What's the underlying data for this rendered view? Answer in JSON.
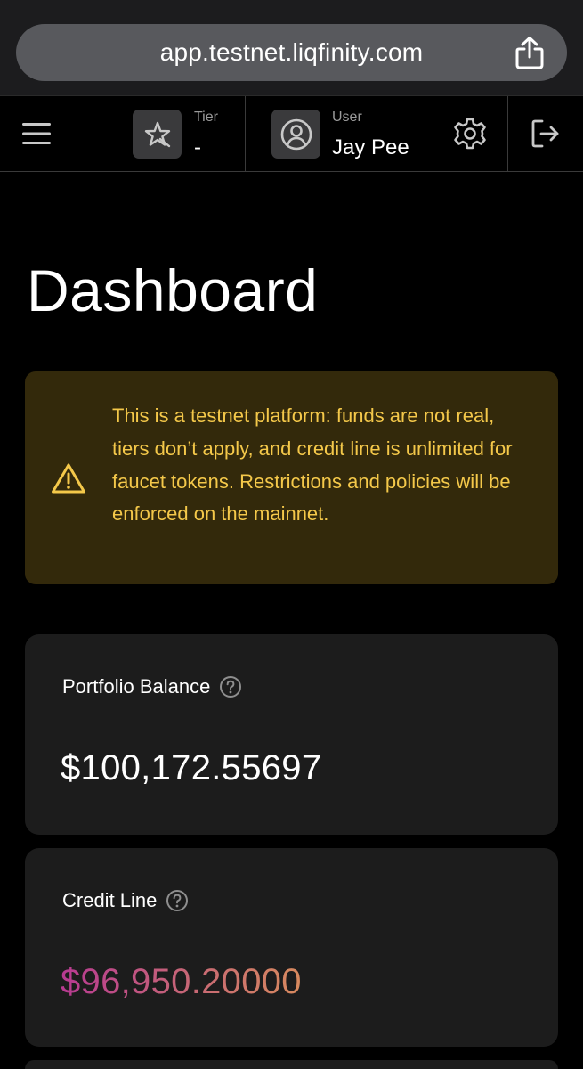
{
  "browser": {
    "url": "app.testnet.liqfinity.com",
    "share_icon": "share-icon"
  },
  "header": {
    "menu_icon": "hamburger-icon",
    "tier": {
      "label": "Tier",
      "value": "-",
      "icon": "star-icon"
    },
    "user": {
      "label": "User",
      "value": "Jay Pee",
      "icon": "user-circle-icon"
    },
    "settings_icon": "gear-icon",
    "logout_icon": "logout-icon"
  },
  "page": {
    "title": "Dashboard"
  },
  "warning": {
    "icon": "warning-triangle-icon",
    "text": "This is a testnet platform: funds are not real, tiers don’t apply, and credit line is unlimited for faucet tokens. Restrictions and policies will be enforced on the mainnet."
  },
  "cards": {
    "portfolio_balance": {
      "label": "Portfolio Balance",
      "value": "$100,172.55697"
    },
    "credit_line": {
      "label": "Credit Line",
      "value": "$96,950.20000"
    }
  },
  "colors": {
    "warning_bg": "#33290b",
    "warning_text": "#f4c84a",
    "card_bg": "#1c1c1c",
    "credit_gradient_start": "#b83a92",
    "credit_gradient_end": "#d88a5e"
  }
}
